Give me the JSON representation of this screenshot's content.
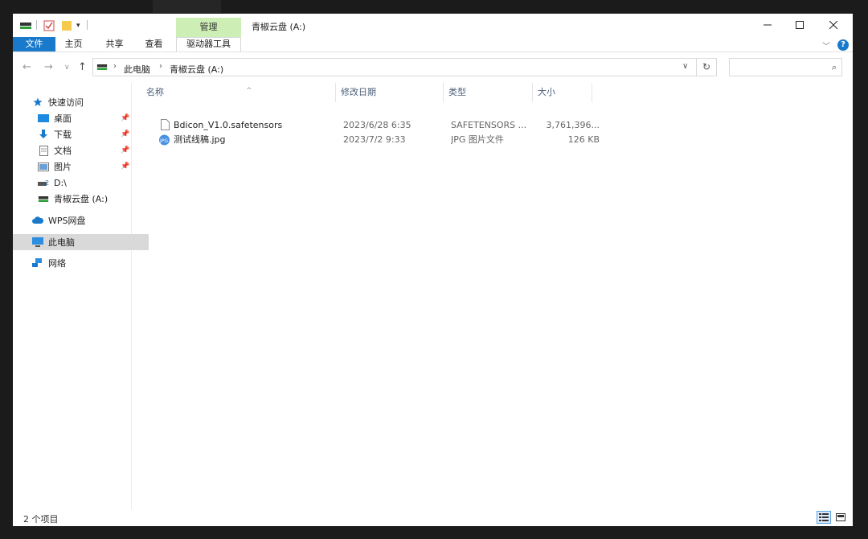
{
  "window": {
    "title": "青椒云盘 (A:)",
    "context_tab_header": "管理"
  },
  "ribbon": {
    "tabs": [
      "文件",
      "主页",
      "共享",
      "查看",
      "驱动器工具"
    ]
  },
  "address": {
    "crumbs": [
      "此电脑",
      "青椒云盘 (A:)"
    ]
  },
  "search": {
    "placeholder": ""
  },
  "sidebar": {
    "items": [
      {
        "label": "快速访问",
        "icon": "star-icon"
      },
      {
        "label": "桌面",
        "icon": "desktop-icon",
        "pinned": true
      },
      {
        "label": "下载",
        "icon": "download-icon",
        "pinned": true
      },
      {
        "label": "文档",
        "icon": "document-icon",
        "pinned": true
      },
      {
        "label": "图片",
        "icon": "pictures-icon",
        "pinned": true
      },
      {
        "label": "D:\\",
        "icon": "drive-icon"
      },
      {
        "label": "青椒云盘 (A:)",
        "icon": "network-drive-icon"
      },
      {
        "label": "WPS网盘",
        "icon": "cloud-icon"
      },
      {
        "label": "此电脑",
        "icon": "computer-icon",
        "selected": true
      },
      {
        "label": "网络",
        "icon": "network-icon"
      }
    ]
  },
  "columns": [
    "名称",
    "修改日期",
    "类型",
    "大小"
  ],
  "files": [
    {
      "name": "Bdicon_V1.0.safetensors",
      "date": "2023/6/28 6:35",
      "type": "SAFETENSORS ...",
      "size": "3,761,396...",
      "icon": "file-icon"
    },
    {
      "name": "测试线稿.jpg",
      "date": "2023/7/2 9:33",
      "type": "JPG 图片文件",
      "size": "126 KB",
      "icon": "jpg-image-icon"
    }
  ],
  "status": {
    "item_count": "2 个项目"
  },
  "colors": {
    "accent": "#1979ca",
    "context_tab": "#cdeeb4",
    "selection": "#d9d9d9"
  }
}
